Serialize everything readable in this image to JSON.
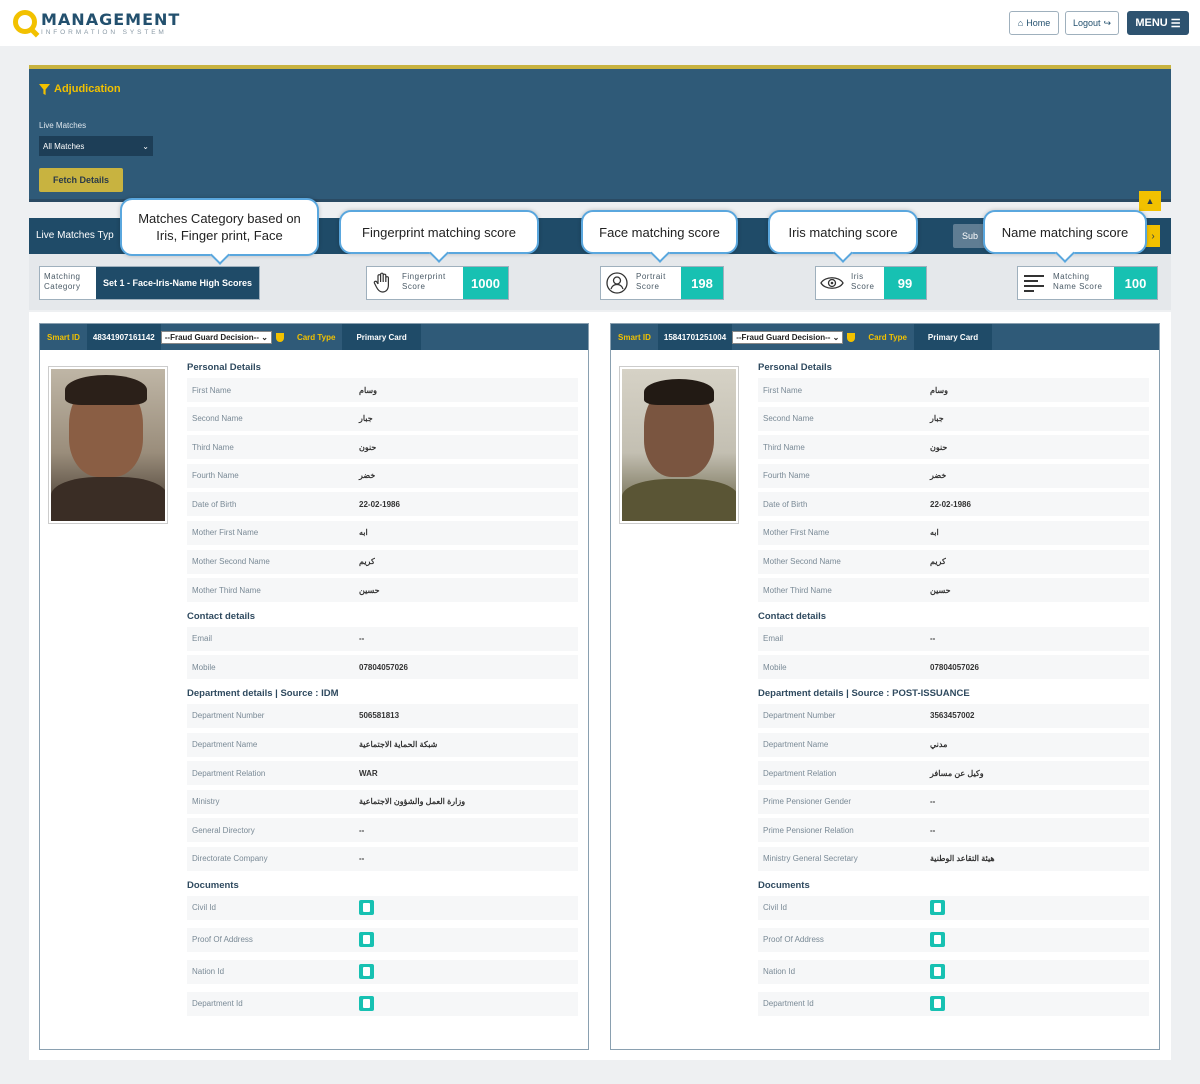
{
  "header": {
    "logo_main": "MANAGEMENT",
    "logo_sub": "INFORMATION SYSTEM",
    "home_label": "Home",
    "logout_label": "Logout",
    "menu_label": "MENU"
  },
  "adjudication": {
    "title": "Adjudication",
    "live_matches_label": "Live Matches",
    "live_matches_value": "All Matches",
    "fetch_label": "Fetch Details"
  },
  "live_bar": {
    "label": "Live Matches Typ",
    "submit_label": "Sub"
  },
  "scores": {
    "matching_category_label": "Matching Category",
    "matching_category_value": "Set 1 - Face-Iris-Name High Scores",
    "fingerprint_label": "Fingerprint Score",
    "fingerprint_value": "1000",
    "portrait_label": "Portrait Score",
    "portrait_value": "198",
    "iris_label": "Iris Score",
    "iris_value": "99",
    "name_label": "Matching Name Score",
    "name_value": "100"
  },
  "callouts": {
    "category": "Matches Category based on Iris, Finger print, Face",
    "fingerprint": "Fingerprint matching score",
    "face": "Face matching score",
    "iris": "Iris matching score",
    "name": "Name matching score"
  },
  "colors": {
    "primary": "#2f5a78",
    "accent": "#f2c100",
    "score": "#17c1b2"
  },
  "card_labels": {
    "smart_id": "Smart ID",
    "fraud_select": "--Fraud Guard Decision--",
    "card_type": "Card Type",
    "personal": "Personal Details",
    "contact": "Contact details",
    "documents": "Documents"
  },
  "left_card": {
    "smart_id": "48341907161142",
    "card_type": "Primary Card",
    "personal": [
      {
        "label": "First Name",
        "value": "وسام"
      },
      {
        "label": "Second Name",
        "value": "جبار"
      },
      {
        "label": "Third Name",
        "value": "حنون"
      },
      {
        "label": "Fourth Name",
        "value": "خضر"
      },
      {
        "label": "Date of Birth",
        "value": "22-02-1986"
      },
      {
        "label": "Mother First Name",
        "value": "ابه"
      },
      {
        "label": "Mother Second Name",
        "value": "كريم"
      },
      {
        "label": "Mother Third Name",
        "value": "حسين"
      }
    ],
    "contact": [
      {
        "label": "Email",
        "value": "--"
      },
      {
        "label": "Mobile",
        "value": "07804057026"
      }
    ],
    "department_title": "Department details | Source : IDM",
    "department": [
      {
        "label": "Department Number",
        "value": "506581813"
      },
      {
        "label": "Department Name",
        "value": "شبكة الحماية الاجتماعية"
      },
      {
        "label": "Department Relation",
        "value": "WAR"
      },
      {
        "label": "Ministry",
        "value": "وزارة العمل والشؤون الاجتماعية"
      },
      {
        "label": "General Directory",
        "value": "--"
      },
      {
        "label": "Directorate Company",
        "value": "--"
      }
    ],
    "documents": [
      "Civil Id",
      "Proof Of Address",
      "Nation Id",
      "Department Id"
    ]
  },
  "right_card": {
    "smart_id": "15841701251004",
    "card_type": "Primary Card",
    "personal": [
      {
        "label": "First Name",
        "value": "وسام"
      },
      {
        "label": "Second Name",
        "value": "جبار"
      },
      {
        "label": "Third Name",
        "value": "حنون"
      },
      {
        "label": "Fourth Name",
        "value": "خضر"
      },
      {
        "label": "Date of Birth",
        "value": "22-02-1986"
      },
      {
        "label": "Mother First Name",
        "value": "ابه"
      },
      {
        "label": "Mother Second Name",
        "value": "كريم"
      },
      {
        "label": "Mother Third Name",
        "value": "حسين"
      }
    ],
    "contact": [
      {
        "label": "Email",
        "value": "--"
      },
      {
        "label": "Mobile",
        "value": "07804057026"
      }
    ],
    "department_title": "Department details | Source : POST-ISSUANCE",
    "department": [
      {
        "label": "Department Number",
        "value": "3563457002"
      },
      {
        "label": "Department Name",
        "value": "مدني"
      },
      {
        "label": "Department Relation",
        "value": "وكيل عن مسافر"
      },
      {
        "label": "Prime Pensioner Gender",
        "value": "--"
      },
      {
        "label": "Prime Pensioner Relation",
        "value": "--"
      },
      {
        "label": "Ministry General Secretary",
        "value": "هيئة التقاعد الوطنية"
      }
    ],
    "documents": [
      "Civil Id",
      "Proof Of Address",
      "Nation Id",
      "Department Id"
    ]
  }
}
